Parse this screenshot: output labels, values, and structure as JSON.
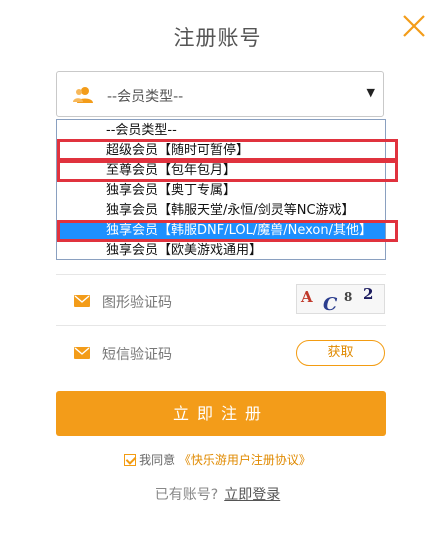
{
  "page": {
    "title": "注册账号"
  },
  "member_select": {
    "selected": "--会员类型--",
    "options": [
      "--会员类型--",
      "超级会员【随时可暂停】",
      "至尊会员【包年包月】",
      "独享会员【奥丁专属】",
      "独享会员【韩服天堂/永恒/剑灵等NC游戏】",
      "独享会员【韩服DNF/LOL/魔兽/Nexon/其他】",
      "独享会员【欧美游戏通用】"
    ],
    "highlighted_option_index": 5
  },
  "captcha": {
    "label": "图形验证码",
    "image_text": [
      "A",
      "C",
      "8",
      "2"
    ]
  },
  "sms": {
    "label": "短信验证码",
    "get_button": "获取"
  },
  "submit_label": "立即注册",
  "agreement": {
    "prefix": "我同意",
    "link": "《快乐游用户注册协议》"
  },
  "login": {
    "prompt": "已有账号?",
    "link": "立即登录"
  },
  "colors": {
    "accent": "#f39c19",
    "highlight": "#1e90ff",
    "annotation": "#e0323e"
  }
}
